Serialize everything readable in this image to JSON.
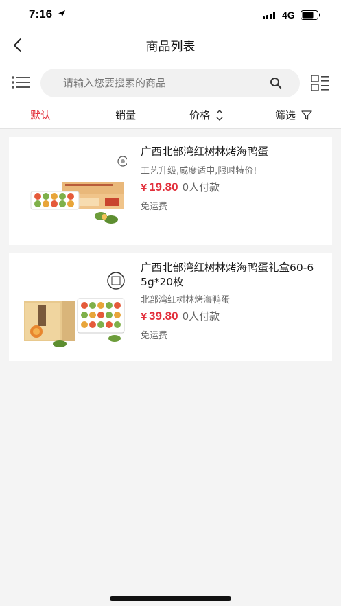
{
  "status_bar": {
    "time": "7:16",
    "network": "4G"
  },
  "header": {
    "title": "商品列表"
  },
  "search": {
    "placeholder": "请输入您要搜索的商品"
  },
  "filters": [
    {
      "label": "默认",
      "active": true
    },
    {
      "label": "销量"
    },
    {
      "label": "价格"
    },
    {
      "label": "筛选"
    }
  ],
  "colors": {
    "accent": "#e2303c",
    "background": "#f4f4f4"
  },
  "products": [
    {
      "name": "广西北部湾红树林烤海鸭蛋",
      "subtitle": "工艺升级,咸度适中,限时特价!",
      "currency": "¥",
      "price": "19.80",
      "paid": "0人付款",
      "shipping": "免运费"
    },
    {
      "name": "广西北部湾红树林烤海鸭蛋礼盒60-65g*20枚",
      "subtitle": "北部湾红树林烤海鸭蛋",
      "currency": "¥",
      "price": "39.80",
      "paid": "0人付款",
      "shipping": "免运费"
    }
  ]
}
